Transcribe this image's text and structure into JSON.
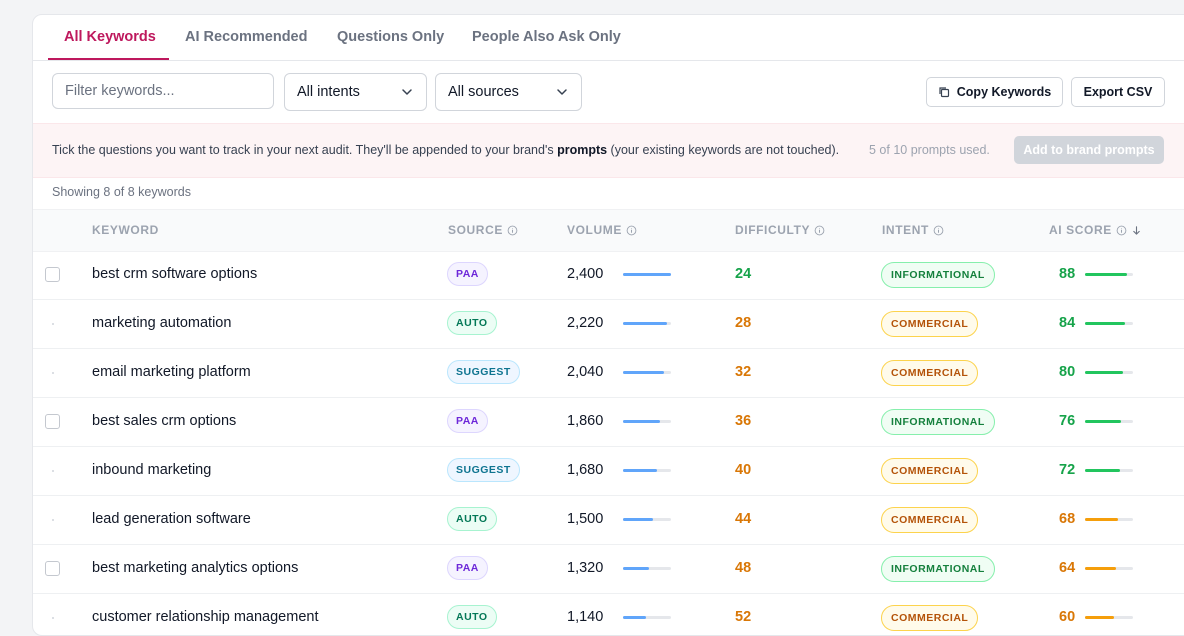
{
  "tabs": [
    {
      "label": "All Keywords"
    },
    {
      "label": "AI Recommended"
    },
    {
      "label": "Questions Only"
    },
    {
      "label": "People Also Ask Only"
    }
  ],
  "filters": {
    "keyword_placeholder": "Filter keywords...",
    "intent_value": "All intents",
    "source_value": "All sources"
  },
  "actions": {
    "copy_label": "Copy Keywords",
    "export_label": "Export CSV"
  },
  "notice": {
    "text_before": "Tick the questions you want to track in your next audit. They'll be appended to your brand's ",
    "text_bold": "prompts",
    "text_after": " (your existing keywords are not touched).",
    "usage": "5 of 10 prompts used.",
    "add_label": "Add to brand prompts"
  },
  "showing": "Showing 8 of 8 keywords",
  "columns": {
    "keyword": "KEYWORD",
    "source": "SOURCE",
    "volume": "VOLUME",
    "difficulty": "DIFFICULTY",
    "intent": "INTENT",
    "ai_score": "AI SCORE"
  },
  "colors": {
    "accent": "#be185d",
    "green": "#16a34a",
    "orange": "#d97706",
    "blue_bar": "#60a5fa",
    "score_green": "#22c55e",
    "score_orange": "#f59e0b"
  },
  "rows": [
    {
      "keyword": "best crm software options",
      "checkbox": true,
      "source": "PAA",
      "volume": "2,400",
      "volume_fill": 1.0,
      "difficulty": "24",
      "intent": "INFORMATIONAL",
      "ai_score": "88",
      "score_fill": 0.88
    },
    {
      "keyword": "marketing automation",
      "checkbox": false,
      "source": "AUTO",
      "volume": "2,220",
      "volume_fill": 0.925,
      "difficulty": "28",
      "intent": "COMMERCIAL",
      "ai_score": "84",
      "score_fill": 0.84
    },
    {
      "keyword": "email marketing platform",
      "checkbox": false,
      "source": "SUGGEST",
      "volume": "2,040",
      "volume_fill": 0.85,
      "difficulty": "32",
      "intent": "COMMERCIAL",
      "ai_score": "80",
      "score_fill": 0.8
    },
    {
      "keyword": "best sales crm options",
      "checkbox": true,
      "source": "PAA",
      "volume": "1,860",
      "volume_fill": 0.775,
      "difficulty": "36",
      "intent": "INFORMATIONAL",
      "ai_score": "76",
      "score_fill": 0.76
    },
    {
      "keyword": "inbound marketing",
      "checkbox": false,
      "source": "SUGGEST",
      "volume": "1,680",
      "volume_fill": 0.7,
      "difficulty": "40",
      "intent": "COMMERCIAL",
      "ai_score": "72",
      "score_fill": 0.72
    },
    {
      "keyword": "lead generation software",
      "checkbox": false,
      "source": "AUTO",
      "volume": "1,500",
      "volume_fill": 0.625,
      "difficulty": "44",
      "intent": "COMMERCIAL",
      "ai_score": "68",
      "score_fill": 0.68
    },
    {
      "keyword": "best marketing analytics options",
      "checkbox": true,
      "source": "PAA",
      "volume": "1,320",
      "volume_fill": 0.55,
      "difficulty": "48",
      "intent": "INFORMATIONAL",
      "ai_score": "64",
      "score_fill": 0.64
    },
    {
      "keyword": "customer relationship management",
      "checkbox": false,
      "source": "AUTO",
      "volume": "1,140",
      "volume_fill": 0.475,
      "difficulty": "52",
      "intent": "COMMERCIAL",
      "ai_score": "60",
      "score_fill": 0.6
    }
  ]
}
